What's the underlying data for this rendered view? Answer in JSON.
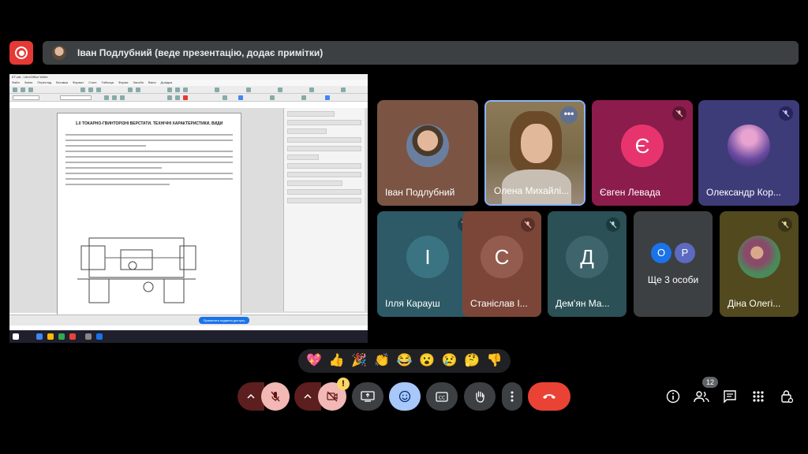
{
  "presenter_bar": {
    "text": "Іван Подлубний (веде презентацію, додає примітки)"
  },
  "shared_screen": {
    "window_title": "ЕТ.odt - LibreOffice Writer",
    "menu": [
      "Файл",
      "Зміни",
      "Перегляд",
      "Вставка",
      "Формат",
      "Стилі",
      "Таблиця",
      "Форма",
      "Засоби",
      "Вікно",
      "Довідка"
    ],
    "doc_heading": "1.0 ТОКАРНО-ГВИНТОРІЗНІ ВЕРСТАТИ. ТЕХНІЧНІ ХАРАКТЕРИСТИКИ, ВИДИ",
    "share_button_label": "Припинити надання доступу"
  },
  "participants": [
    {
      "name": "Іван Подлубний",
      "type": "photo",
      "muted": false,
      "bg": "#7b5444"
    },
    {
      "name": "Олена Михайлі...",
      "type": "video",
      "muted": false,
      "bg": "#6d5a3c",
      "active": true
    },
    {
      "name": "Євген Левада",
      "type": "letter",
      "letter": "Є",
      "muted": true,
      "bg": "#8c1c4b",
      "avatar_color": "#e8346e"
    },
    {
      "name": "Олександр Кор...",
      "type": "photo",
      "muted": true,
      "bg": "#3d3b78"
    },
    {
      "name": "Ілля Карауш",
      "type": "letter",
      "letter": "І",
      "muted": true,
      "bg": "#2d5a66",
      "avatar_color": "#3a7482"
    },
    {
      "name": "Станіслав І...",
      "type": "letter",
      "letter": "С",
      "muted": true,
      "bg": "#7b4638",
      "avatar_color": "#945c4e"
    },
    {
      "name": "Дем'ян Ма...",
      "type": "letter",
      "letter": "Д",
      "muted": true,
      "bg": "#2b5056",
      "avatar_color": "#3e656b"
    },
    {
      "name": "Ще 3 особи",
      "type": "others",
      "letters": [
        "О",
        "Р"
      ],
      "bg": "#3c4043"
    },
    {
      "name": "Діна Олегі...",
      "type": "photo",
      "muted": true,
      "bg": "#52491f"
    }
  ],
  "reactions": [
    "💖",
    "👍",
    "🎉",
    "👏",
    "😂",
    "😮",
    "😢",
    "🤔",
    "👎"
  ],
  "controls": {
    "participants_count": "12",
    "warning_mark": "!"
  }
}
